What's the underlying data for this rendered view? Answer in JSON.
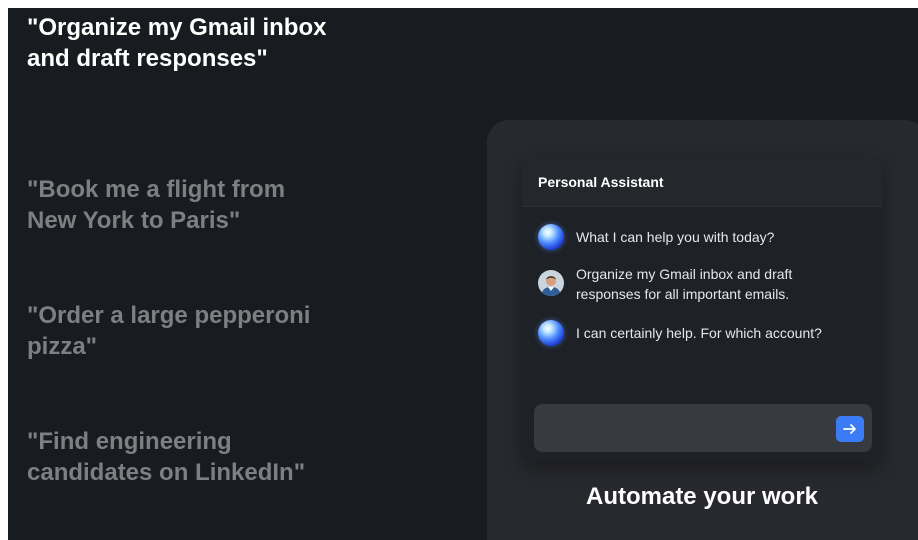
{
  "prompts": [
    {
      "text": "\"Organize my Gmail inbox and draft responses\"",
      "active": true
    },
    {
      "text": "\"Book me a flight from New York to Paris\"",
      "active": false
    },
    {
      "text": "\"Order a large pepperoni pizza\"",
      "active": false
    },
    {
      "text": "\"Find engineering candidates on LinkedIn\"",
      "active": false
    }
  ],
  "chat": {
    "title": "Personal Assistant",
    "messages": [
      {
        "sender": "assistant",
        "icon": "assistant-orb-icon",
        "text": "What I can help you with today?"
      },
      {
        "sender": "user",
        "icon": "user-avatar",
        "text": "Organize my Gmail inbox and draft responses for all important emails."
      },
      {
        "sender": "assistant",
        "icon": "assistant-orb-icon",
        "text": "I can certainly help. For which account?"
      }
    ],
    "input": {
      "value": "",
      "placeholder": ""
    },
    "send_icon": "arrow-right-icon"
  },
  "panel_caption": "Automate your work",
  "colors": {
    "background": "#181b1f",
    "panel": "#28292e",
    "card": "#1e2126",
    "accent": "#3b7cf6",
    "active_text": "#ffffff",
    "inactive_text": "#7d7f83"
  }
}
